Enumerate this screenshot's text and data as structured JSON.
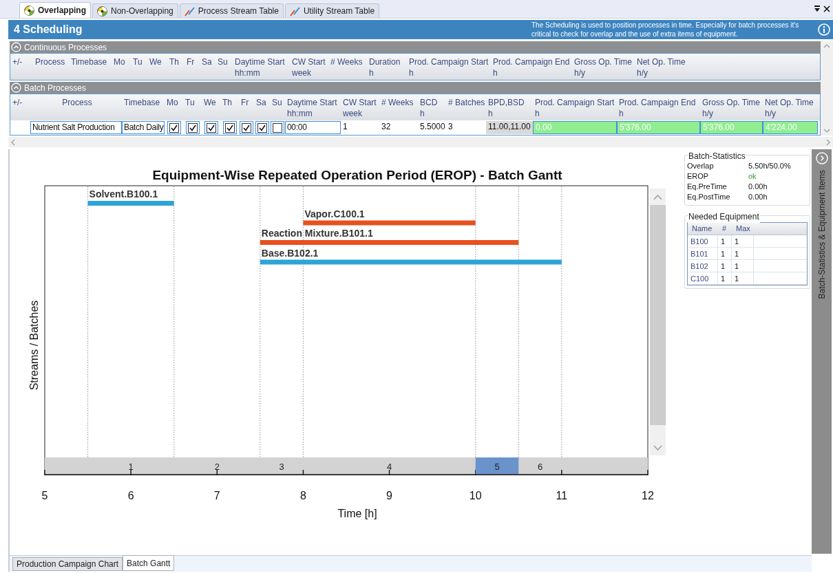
{
  "tabs": [
    {
      "label": "Overlapping",
      "selected": true,
      "kind": "globe"
    },
    {
      "label": "Non-Overlapping",
      "selected": false,
      "kind": "globe"
    },
    {
      "label": "Process Stream Table",
      "selected": false,
      "kind": "chart"
    },
    {
      "label": "Utility Stream Table",
      "selected": false,
      "kind": "chart"
    }
  ],
  "header": {
    "title": "4 Scheduling",
    "description": "The Scheduling is used to position processes in time. Especially for batch processes it's critical to check for overlap and the use of extra items of equipment."
  },
  "continuous": {
    "title": "Continuous Processes",
    "expanded": true,
    "columns": [
      {
        "label": "+/-"
      },
      {
        "label": "Process"
      },
      {
        "label": "Timebase"
      },
      {
        "label": "Mo"
      },
      {
        "label": "Tu"
      },
      {
        "label": "We"
      },
      {
        "label": "Th"
      },
      {
        "label": "Fr"
      },
      {
        "label": "Sa"
      },
      {
        "label": "Su"
      },
      {
        "label": "Daytime Start",
        "unit": "hh:mm"
      },
      {
        "label": "CW Start",
        "unit": "week"
      },
      {
        "label": "# Weeks"
      },
      {
        "label": "Duration",
        "unit": "h"
      },
      {
        "label": "Prod. Campaign Start",
        "unit": "h"
      },
      {
        "label": "Prod. Campaign End",
        "unit": "h"
      },
      {
        "label": "Gross Op. Time",
        "unit": "h/y"
      },
      {
        "label": "Net Op. Time",
        "unit": "h/y"
      }
    ]
  },
  "batch": {
    "title": "Batch Processes",
    "expanded": true,
    "columns": [
      {
        "label": "+/-"
      },
      {
        "label": "Process"
      },
      {
        "label": "Timebase"
      },
      {
        "label": "Mo"
      },
      {
        "label": "Tu"
      },
      {
        "label": "We"
      },
      {
        "label": "Th"
      },
      {
        "label": "Fr"
      },
      {
        "label": "Sa"
      },
      {
        "label": "Su"
      },
      {
        "label": "Daytime Start",
        "unit": "hh:mm"
      },
      {
        "label": "CW Start",
        "unit": "week"
      },
      {
        "label": "# Weeks"
      },
      {
        "label": "BCD",
        "unit": "h"
      },
      {
        "label": "# Batches"
      },
      {
        "label": "BPD,BSD",
        "unit": "h"
      },
      {
        "label": "Prod. Campaign Start",
        "unit": "h"
      },
      {
        "label": "Prod. Campaign End",
        "unit": "h"
      },
      {
        "label": "Gross Op. Time",
        "unit": "h/y"
      },
      {
        "label": "Net Op. Time",
        "unit": "h/y"
      }
    ],
    "rows": [
      {
        "cells": [
          {
            "kind": "empty"
          },
          {
            "kind": "field",
            "text": "Nutrient Salt Production"
          },
          {
            "kind": "field",
            "text": "Batch Daily"
          },
          {
            "kind": "checkbox",
            "checked": true
          },
          {
            "kind": "checkbox",
            "checked": true
          },
          {
            "kind": "checkbox",
            "checked": true
          },
          {
            "kind": "checkbox",
            "checked": true
          },
          {
            "kind": "checkbox",
            "checked": true
          },
          {
            "kind": "checkbox",
            "checked": true
          },
          {
            "kind": "checkbox",
            "checked": false
          },
          {
            "kind": "field",
            "text": "00:00"
          },
          {
            "kind": "plain",
            "text": "1"
          },
          {
            "kind": "plain",
            "text": "32"
          },
          {
            "kind": "plain",
            "text": "5.5000"
          },
          {
            "kind": "plain",
            "text": "3"
          },
          {
            "kind": "computed",
            "text": "11.00,11.00"
          },
          {
            "kind": "result",
            "text": "0.00"
          },
          {
            "kind": "result",
            "text": "5'376.00"
          },
          {
            "kind": "result",
            "text": "5'376.00"
          },
          {
            "kind": "result",
            "text": "4'224.00"
          }
        ]
      }
    ]
  },
  "gantt": {
    "title": "Equipment-Wise Repeated Operation Period (EROP) - Batch Gantt",
    "ylabel": "Streams / Batches",
    "xlabel": "Time [h]",
    "xticks": [
      "5",
      "6",
      "7",
      "8",
      "9",
      "10",
      "11",
      "12"
    ],
    "bars": [
      {
        "label": "Solvent.B100.1",
        "color": "#2ea3da"
      },
      {
        "label": "Vapor.C100.1",
        "color": "#e8501e"
      },
      {
        "label": "Reaction Mixture.B101.1",
        "color": "#e8501e"
      },
      {
        "label": "Base.B102.1",
        "color": "#2ea3da"
      }
    ],
    "periods": [
      {
        "label": "1",
        "selected": false
      },
      {
        "label": "2",
        "selected": false
      },
      {
        "label": "3",
        "selected": false
      },
      {
        "label": "4",
        "selected": false
      },
      {
        "label": "5",
        "selected": true
      },
      {
        "label": "6",
        "selected": false
      }
    ]
  },
  "batch_statistics": {
    "title": "Batch-Statistics",
    "rows": [
      {
        "label": "Overlap",
        "value": "5.50h/50.0%",
        "kind": "plain"
      },
      {
        "label": "EROP",
        "value": "ok",
        "kind": "status"
      },
      {
        "label": "Eq.PreTime",
        "value": "0.00h",
        "kind": "plain"
      },
      {
        "label": "Eq.PostTime",
        "value": "0.00h",
        "kind": "plain"
      }
    ]
  },
  "needed_equipment": {
    "title": "Needed Equipment",
    "columns": [
      "Name",
      "#",
      "Max"
    ],
    "rows": [
      [
        "B100",
        "1",
        "1"
      ],
      [
        "B101",
        "1",
        "1"
      ],
      [
        "B102",
        "1",
        "1"
      ],
      [
        "C100",
        "1",
        "1"
      ]
    ]
  },
  "side_panel": {
    "title": "Batch-Statistics & Equipment Items"
  },
  "bottom_tabs": [
    {
      "label": "Production Campaign Chart",
      "selected": false
    },
    {
      "label": "Batch Gantt",
      "selected": true
    }
  ]
}
